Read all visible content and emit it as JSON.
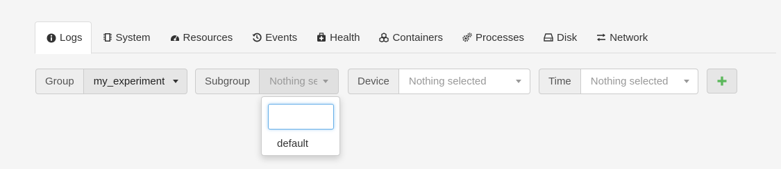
{
  "tabs": [
    {
      "label": "Logs",
      "icon": "info-circle-icon",
      "active": true
    },
    {
      "label": "System",
      "icon": "chip-icon",
      "active": false
    },
    {
      "label": "Resources",
      "icon": "dashboard-icon",
      "active": false
    },
    {
      "label": "Events",
      "icon": "history-icon",
      "active": false
    },
    {
      "label": "Health",
      "icon": "medkit-icon",
      "active": false
    },
    {
      "label": "Containers",
      "icon": "cubes-icon",
      "active": false
    },
    {
      "label": "Processes",
      "icon": "cogs-icon",
      "active": false
    },
    {
      "label": "Disk",
      "icon": "hdd-icon",
      "active": false
    },
    {
      "label": "Network",
      "icon": "exchange-icon",
      "active": false
    }
  ],
  "filters": {
    "group": {
      "label": "Group",
      "value": "my_experiment"
    },
    "subgroup": {
      "label": "Subgroup",
      "value": "Nothing selected",
      "display": "Nothing se"
    },
    "device": {
      "label": "Device",
      "value": "Nothing selected"
    },
    "time": {
      "label": "Time",
      "value": "Nothing selected"
    }
  },
  "add_button": {
    "icon": "plus-icon",
    "color": "#5cb85c"
  },
  "subgroup_dropdown": {
    "search_value": "",
    "options": [
      "default"
    ]
  },
  "colors": {
    "focus_border": "#66afe9",
    "placeholder": "#999999"
  }
}
